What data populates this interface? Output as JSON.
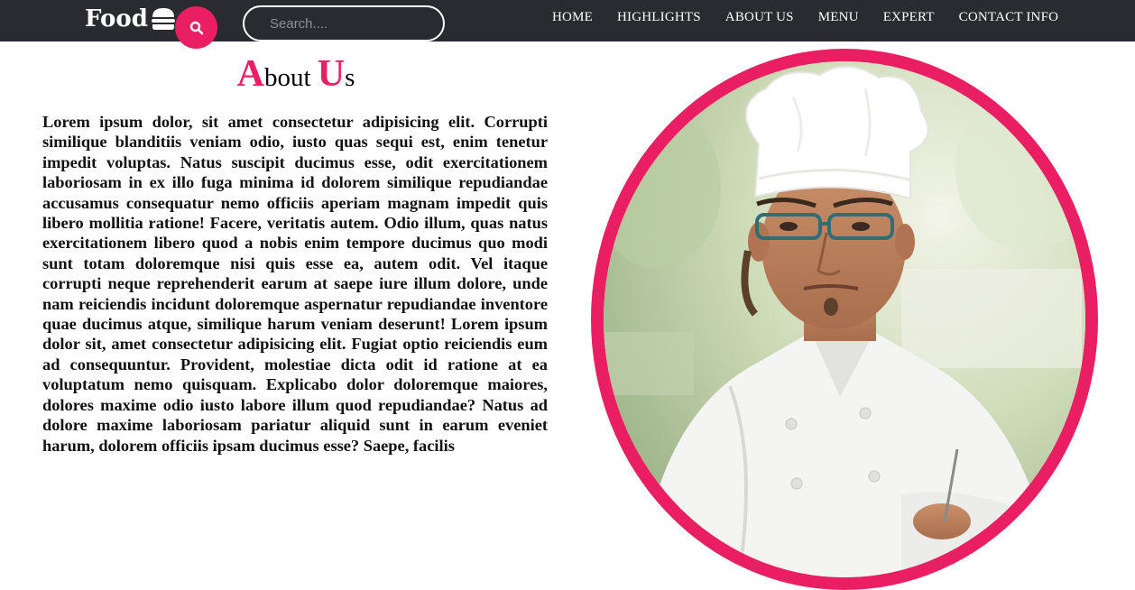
{
  "header": {
    "logo_text": "Food",
    "search_placeholder": "Search....",
    "nav": [
      "HOME",
      "HIGHLIGHTS",
      "ABOUT US",
      "MENU",
      "EXPERT",
      "CONTACT INFO"
    ]
  },
  "about": {
    "title_part1_initial": "A",
    "title_part1_rest": "bout",
    "title_part2_initial": "U",
    "title_part2_rest": "s",
    "paragraph": "Lorem ipsum dolor, sit amet consectetur adipisicing elit. Corrupti similique blanditiis veniam odio, iusto quas sequi est, enim tenetur impedit voluptas. Natus suscipit ducimus esse, odit exercitationem laboriosam in ex illo fuga minima id dolorem similique repudiandae accusamus consequatur nemo officiis aperiam magnam impedit quis libero mollitia ratione! Facere, veritatis autem. Odio illum, quas natus exercitationem libero quod a nobis enim tempore ducimus quo modi sunt totam doloremque nisi quis esse ea, autem odit. Vel itaque corrupti neque reprehenderit earum at saepe iure illum dolore, unde nam reiciendis incidunt doloremque aspernatur repudiandae inventore quae ducimus atque, similique harum veniam deserunt! Lorem ipsum dolor sit, amet consectetur adipisicing elit. Fugiat optio reiciendis eum ad consequuntur. Provident, molestiae dicta odit id ratione at ea voluptatum nemo quisquam. Explicabo dolor doloremque maiores, dolores maxime odio iusto labore illum quod repudiandae? Natus ad dolore maxime laboriosam pariatur aliquid sunt in earum eveniet harum, dolorem officiis ipsam ducimus esse? Saepe, facilis"
  },
  "icons": {
    "logo_icon": "burger-icon",
    "search_icon": "search-icon"
  },
  "colors": {
    "accent": "#e91e63",
    "navbar_bg": "#2a2b30",
    "nav_text": "#ffffff"
  }
}
